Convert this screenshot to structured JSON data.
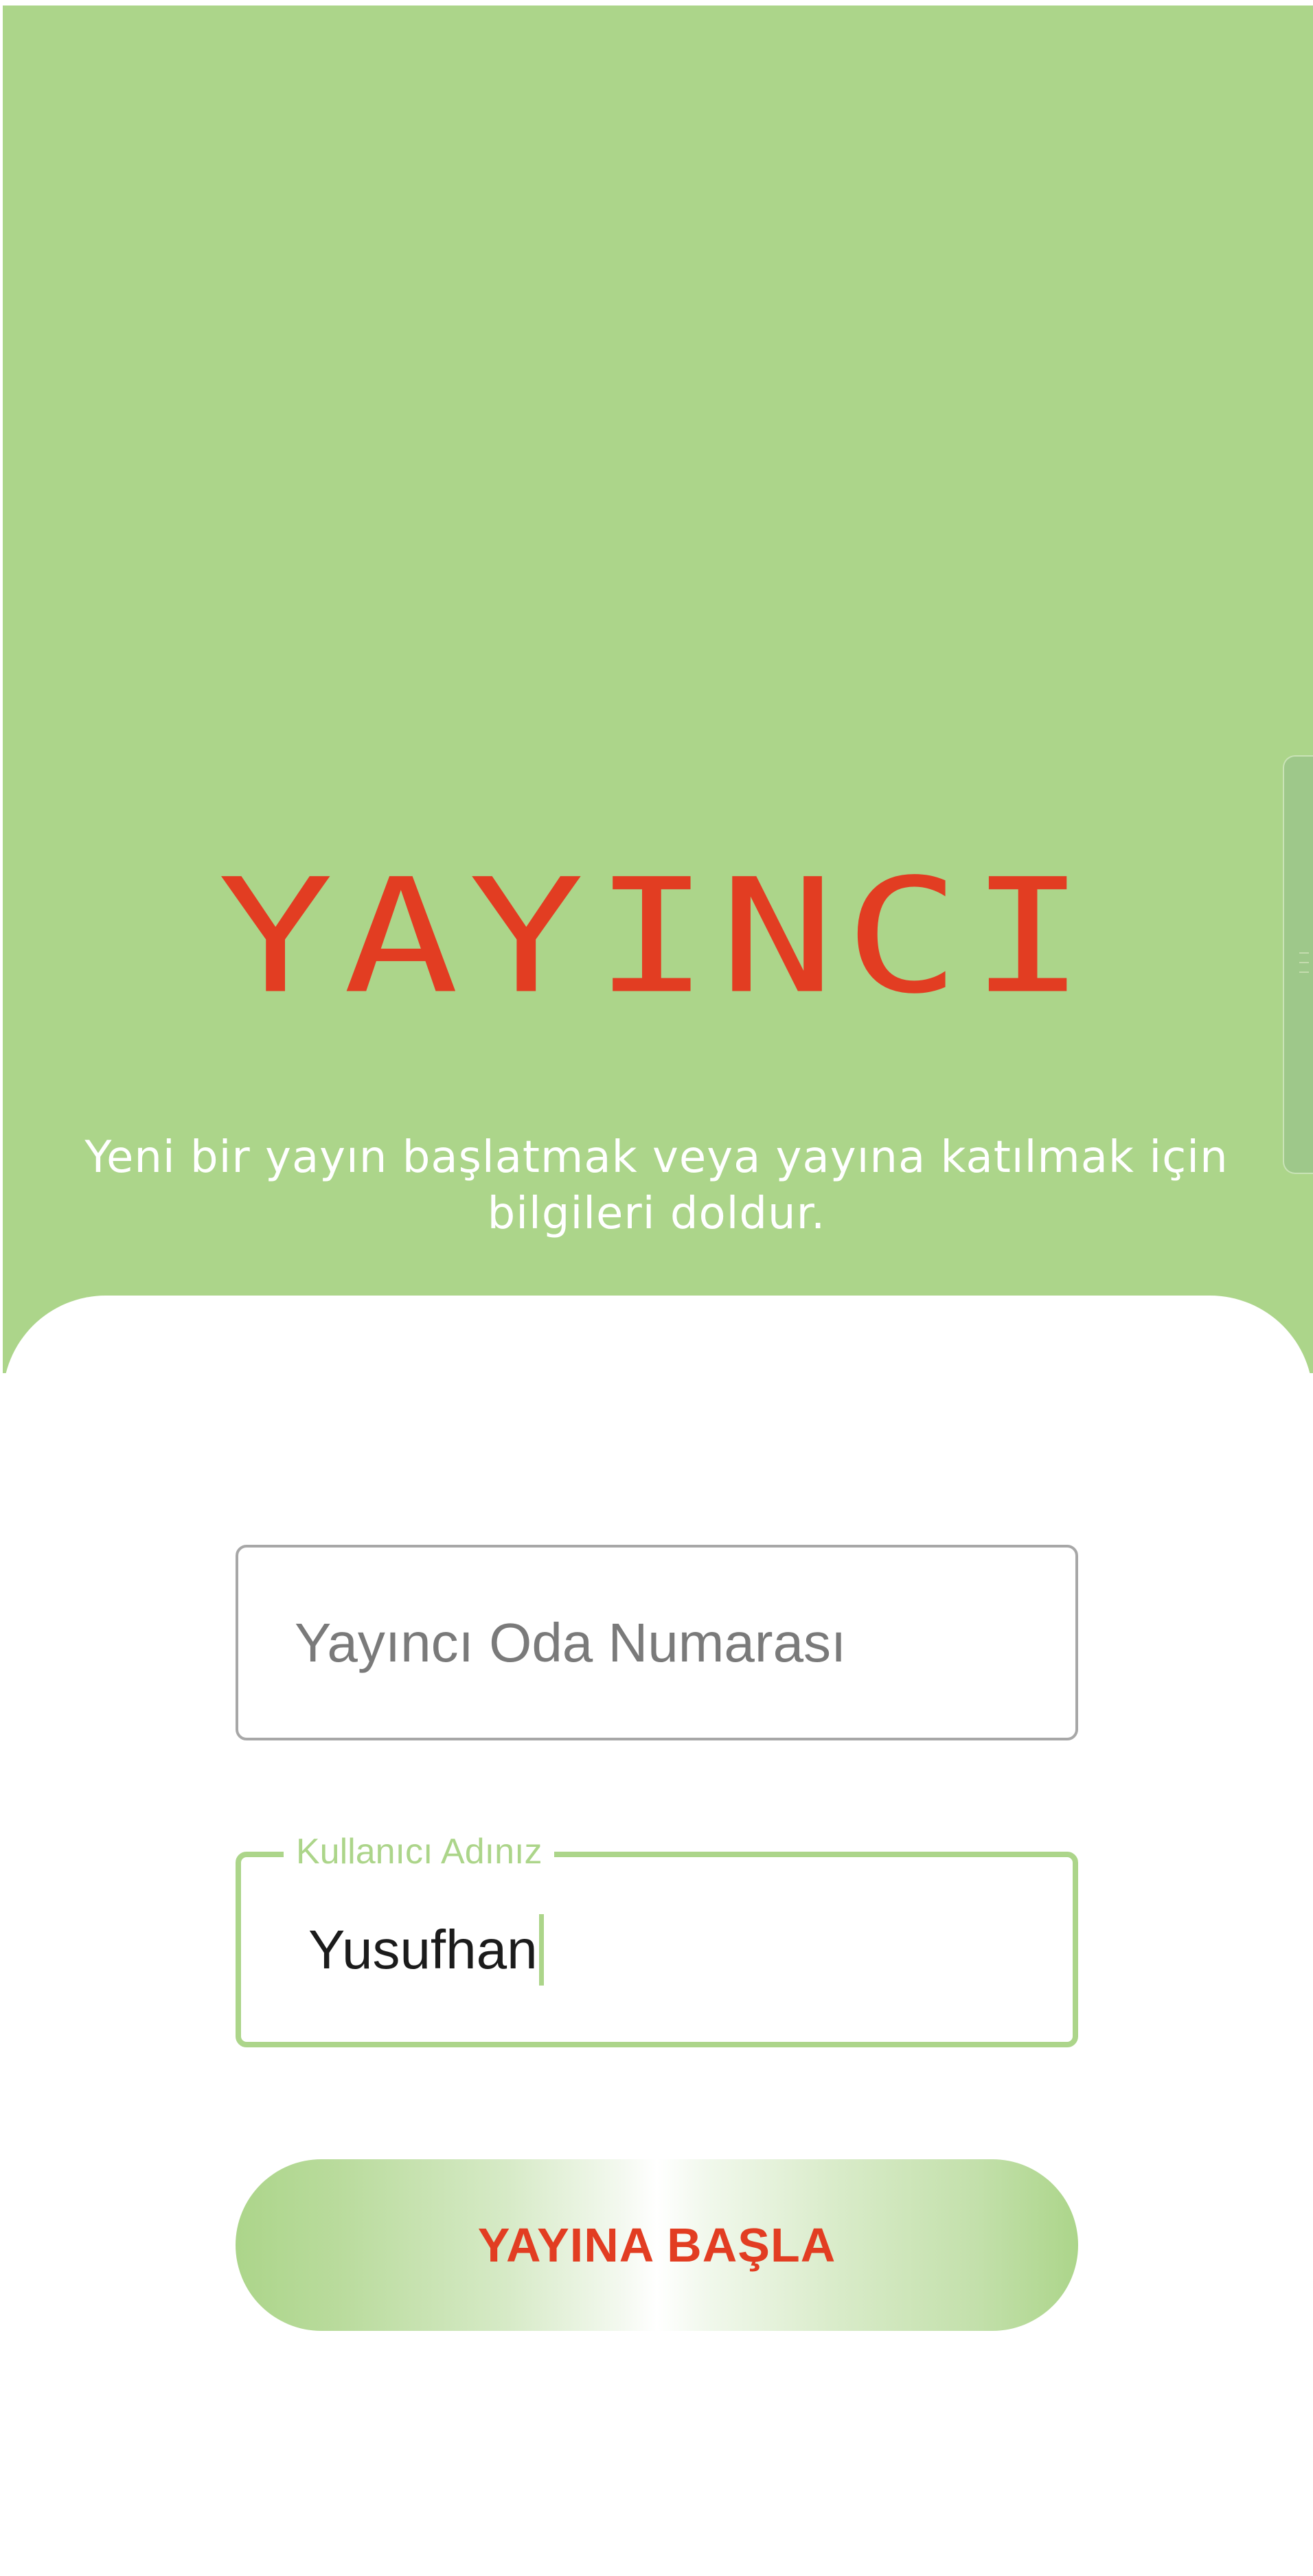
{
  "header": {
    "title": "YAYINCI",
    "subtitle": "Yeni bir yayın başlatmak veya yayına katılmak için bilgileri doldur."
  },
  "form": {
    "room_number": {
      "placeholder": "Yayıncı Oda Numarası",
      "value": ""
    },
    "username": {
      "label": "Kullanıcı Adınız",
      "value": "Yusufhan"
    },
    "start_button_label": "YAYINA BAŞLA"
  },
  "colors": {
    "header_background": "#acd58a",
    "title": "#e23d22",
    "accent": "#acd58a",
    "button_text": "#e23d22",
    "field_border": "#a7a7a7"
  },
  "icons": {
    "scroll_handle": "drag-handle-icon"
  }
}
